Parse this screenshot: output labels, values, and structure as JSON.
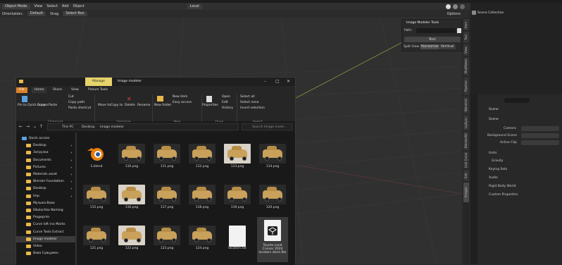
{
  "blender": {
    "header": {
      "mode": "Object Mode",
      "menus": [
        "View",
        "Select",
        "Add",
        "Object"
      ],
      "transform": "Local",
      "options": "Options"
    },
    "toolbar": {
      "orientation_label": "Orientation:",
      "orientation_value": "Default",
      "drag_label": "Drag",
      "drag_value": "Select Box"
    },
    "npanel": {
      "title": "Image Modeler Tools",
      "path_label": "Path:",
      "run": "Run",
      "split_label": "Split View",
      "split_h": "Horizontal",
      "split_v": "Vertical"
    },
    "sidebar_tabs": [
      "Item",
      "Tool",
      "View",
      "ModMaker",
      "Pipeline",
      "Blendmit",
      "LipSync",
      "BlenderKit",
      "Link Curve",
      "Edit",
      "Images"
    ],
    "outliner": {
      "title": "Scene Collection"
    },
    "properties": {
      "scene_header": "Scene",
      "section": "Scene",
      "camera_label": "Camera",
      "bg_label": "Background Scene",
      "clip_label": "Active Clip",
      "panels": [
        "Units",
        "Gravity",
        "Keying Sets",
        "Audio",
        "Rigid Body World",
        "Custom Properties"
      ]
    }
  },
  "explorer": {
    "title": "Image modeler",
    "manage_tab": "Manage",
    "tabs": [
      "File",
      "Home",
      "Share",
      "View",
      "Picture Tools"
    ],
    "ribbon": {
      "clipboard": {
        "label": "Clipboard",
        "pin": "Pin to Quick access",
        "copy": "Copy",
        "paste": "Paste",
        "cut": "Cut",
        "copy_path": "Copy path",
        "paste_shortcut": "Paste shortcut"
      },
      "organize": {
        "label": "Organize",
        "move": "Move to",
        "copy": "Copy to",
        "delete": "Delete",
        "rename": "Rename"
      },
      "new": {
        "label": "New",
        "folder": "New folder",
        "item": "New item",
        "easy": "Easy access"
      },
      "open": {
        "label": "Open",
        "properties": "Properties",
        "open": "Open",
        "edit": "Edit",
        "history": "History"
      },
      "select": {
        "label": "Select",
        "all": "Select all",
        "none": "Select none",
        "invert": "Invert selection"
      }
    },
    "address": [
      "This PC",
      "Desktop",
      "Image modeler"
    ],
    "search_placeholder": "Search Image mode...",
    "nav": [
      "Quick access",
      "Desktop",
      "Загрузки",
      "Documents",
      "Pictures",
      "Materials asset",
      "Blender Foundation",
      "Desktop",
      "tmp",
      "Музыка Вова",
      "Obolochka Naming",
      "Progeprim",
      "Curve loft (no Marks",
      "Curve Tools Extract",
      "Image modeler",
      "Video",
      "Вова Сувцумен"
    ],
    "files": [
      {
        "name": "1.blend",
        "kind": "blend"
      },
      {
        "name": "110.png",
        "kind": "car"
      },
      {
        "name": "111.png",
        "kind": "car"
      },
      {
        "name": "112.png",
        "kind": "car"
      },
      {
        "name": "113.png",
        "kind": "carlight"
      },
      {
        "name": "114.png",
        "kind": "car"
      },
      {
        "name": "115.png",
        "kind": "car"
      },
      {
        "name": "116.png",
        "kind": "carlight"
      },
      {
        "name": "117.png",
        "kind": "car"
      },
      {
        "name": "118.png",
        "kind": "car"
      },
      {
        "name": "119.png",
        "kind": "car"
      },
      {
        "name": "120.png",
        "kind": "car"
      },
      {
        "name": "121.png",
        "kind": "car"
      },
      {
        "name": "122.png",
        "kind": "carlight"
      },
      {
        "name": "123.png",
        "kind": "car"
      },
      {
        "name": "124.png",
        "kind": "car"
      },
      {
        "name": "locators.txt",
        "kind": "doc"
      },
      {
        "name": "Toyota Land Cruiser 2024 locators done.fbx",
        "kind": "fbx"
      }
    ]
  }
}
